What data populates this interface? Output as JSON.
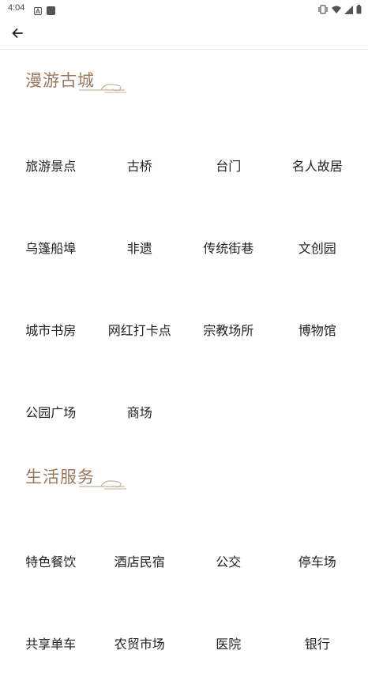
{
  "status_bar": {
    "time": "4:04"
  },
  "header": {
    "back_icon": "arrow-left-icon"
  },
  "sections": [
    {
      "title": "漫游古城",
      "items": [
        [
          "旅游景点",
          "古桥",
          "台门",
          "名人故居"
        ],
        [
          "乌篷船埠",
          "非遗",
          "传统街巷",
          "文创园"
        ],
        [
          "城市书房",
          "网红打卡点",
          "宗教场所",
          "博物馆"
        ],
        [
          "公园广场",
          "商场"
        ]
      ]
    },
    {
      "title": "生活服务",
      "items": [
        [
          "特色餐饮",
          "酒店民宿",
          "公交",
          "停车场"
        ],
        [
          "共享单车",
          "农贸市场",
          "医院",
          "银行"
        ]
      ]
    }
  ],
  "colors": {
    "section_title": "#9a7a5c"
  }
}
